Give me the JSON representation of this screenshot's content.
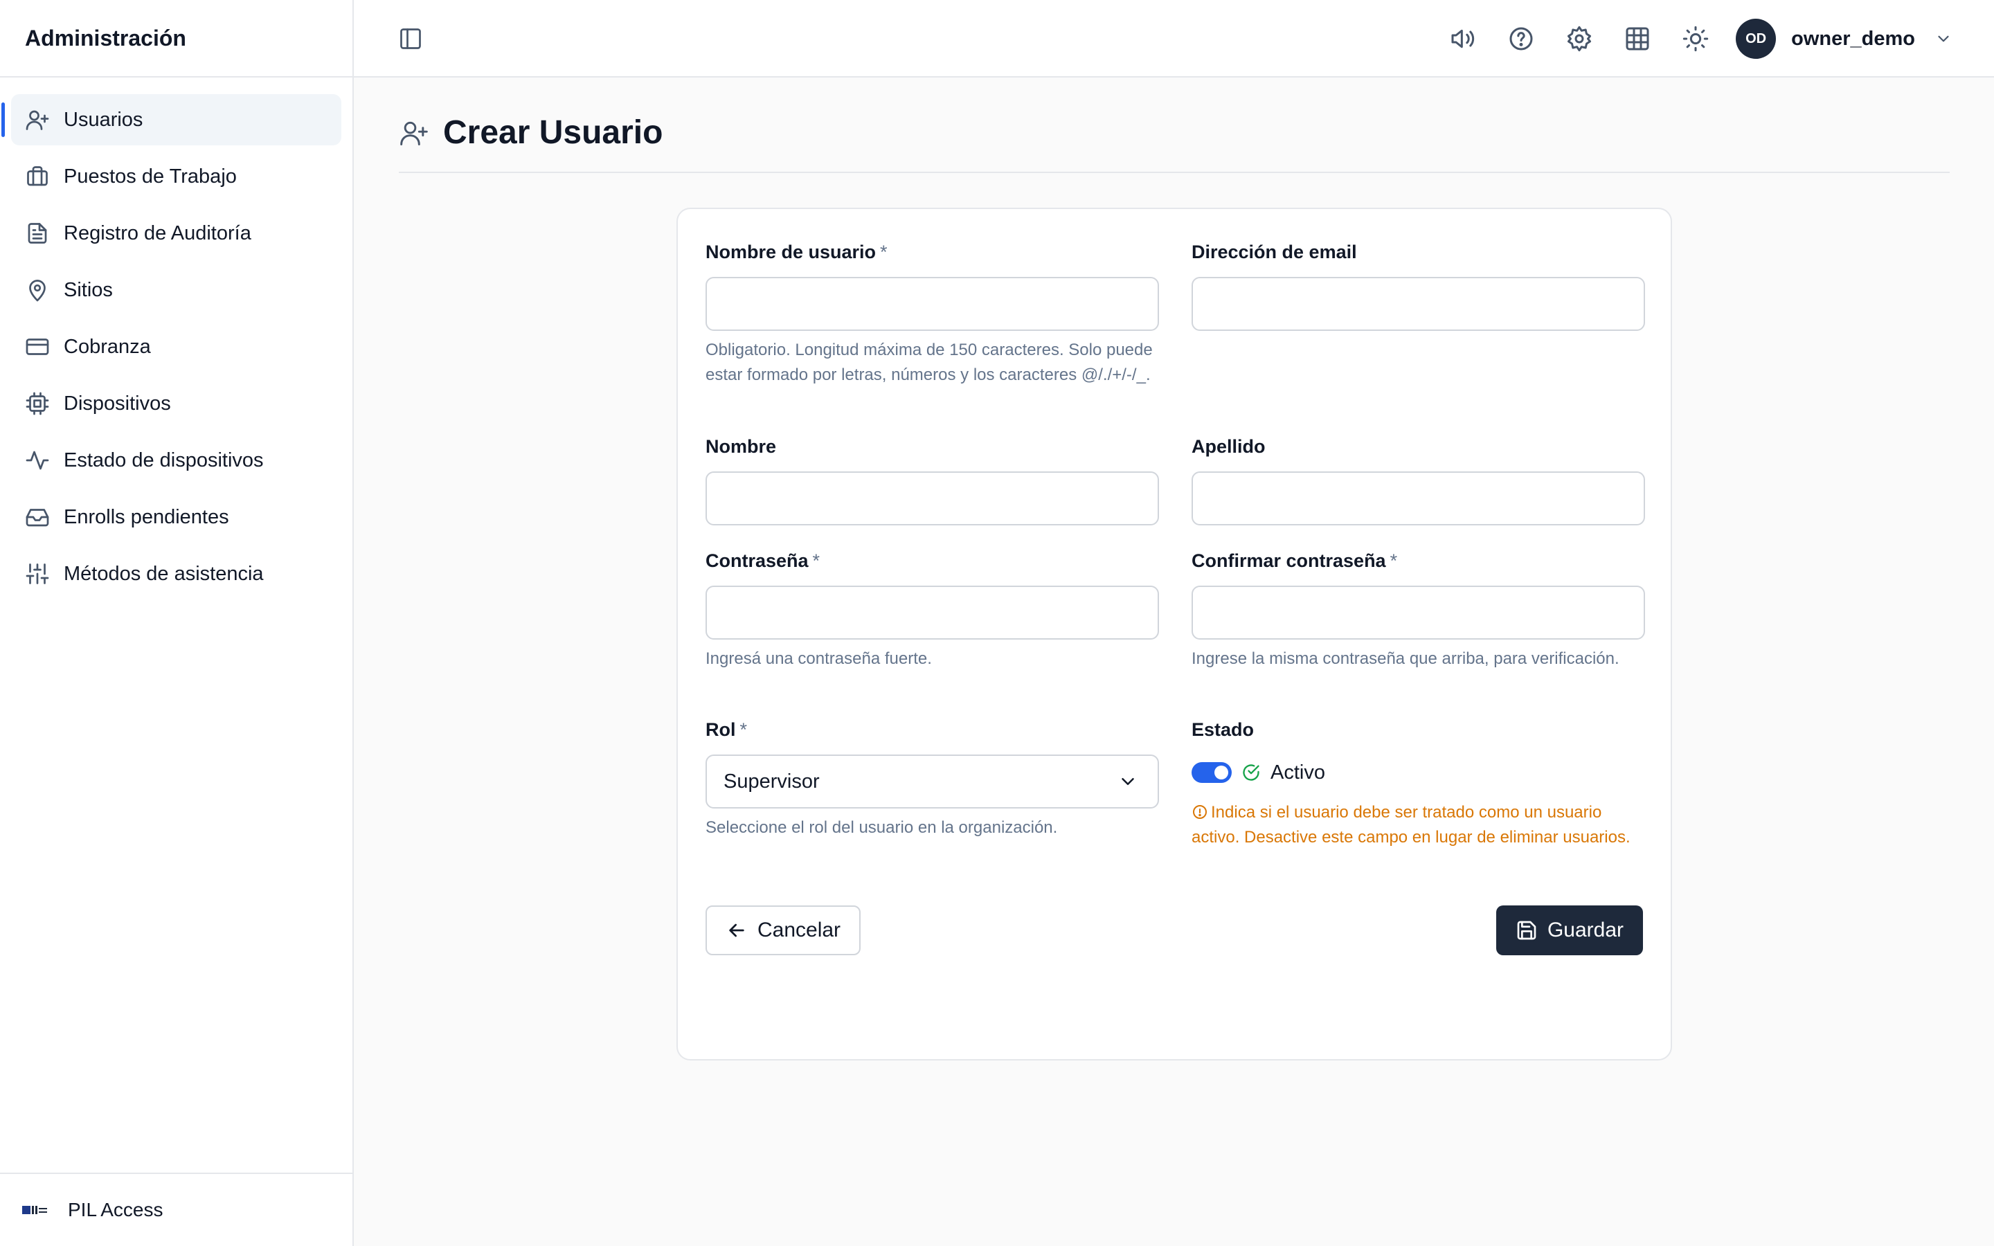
{
  "sidebar": {
    "title": "Administración",
    "items": [
      {
        "label": "Usuarios",
        "icon": "user-plus-icon",
        "active": true
      },
      {
        "label": "Puestos de Trabajo",
        "icon": "briefcase-icon"
      },
      {
        "label": "Registro de Auditoría",
        "icon": "document-icon"
      },
      {
        "label": "Sitios",
        "icon": "map-pin-icon"
      },
      {
        "label": "Cobranza",
        "icon": "credit-card-icon"
      },
      {
        "label": "Dispositivos",
        "icon": "cpu-icon"
      },
      {
        "label": "Estado de dispositivos",
        "icon": "activity-icon"
      },
      {
        "label": "Enrolls pendientes",
        "icon": "inbox-icon"
      },
      {
        "label": "Métodos de asistencia",
        "icon": "sliders-icon"
      }
    ],
    "footer": {
      "brand": "PIL Access"
    }
  },
  "topbar": {
    "icons": [
      "megaphone-icon",
      "help-circle-icon",
      "gear-icon",
      "grid-icon",
      "sun-icon"
    ],
    "user": {
      "initials": "OD",
      "name": "owner_demo"
    }
  },
  "page": {
    "title": "Crear Usuario"
  },
  "form": {
    "username": {
      "label": "Nombre de usuario",
      "required": "*",
      "value": "",
      "help": "Obligatorio. Longitud máxima de 150 caracteres. Solo puede estar formado por letras, números y los caracteres @/./+/-/_."
    },
    "email": {
      "label": "Dirección de email",
      "value": ""
    },
    "first_name": {
      "label": "Nombre",
      "value": ""
    },
    "last_name": {
      "label": "Apellido",
      "value": ""
    },
    "password": {
      "label": "Contraseña",
      "required": "*",
      "value": "",
      "help": "Ingresá una contraseña fuerte."
    },
    "password_confirm": {
      "label": "Confirmar contraseña",
      "required": "*",
      "value": "",
      "help": "Ingrese la misma contraseña que arriba, para verificación."
    },
    "role": {
      "label": "Rol",
      "required": "*",
      "value": "Supervisor",
      "help": "Seleccione el rol del usuario en la organización."
    },
    "status": {
      "label": "Estado",
      "toggle_on": true,
      "toggle_label": "Activo",
      "warning": "Indica si el usuario debe ser tratado como un usuario activo. Desactive este campo en lugar de eliminar usuarios."
    },
    "cancel_label": "Cancelar",
    "save_label": "Guardar"
  },
  "colors": {
    "accent": "#2563eb",
    "primary_button": "#1e293b",
    "warning": "#d97706",
    "muted": "#64748b"
  }
}
